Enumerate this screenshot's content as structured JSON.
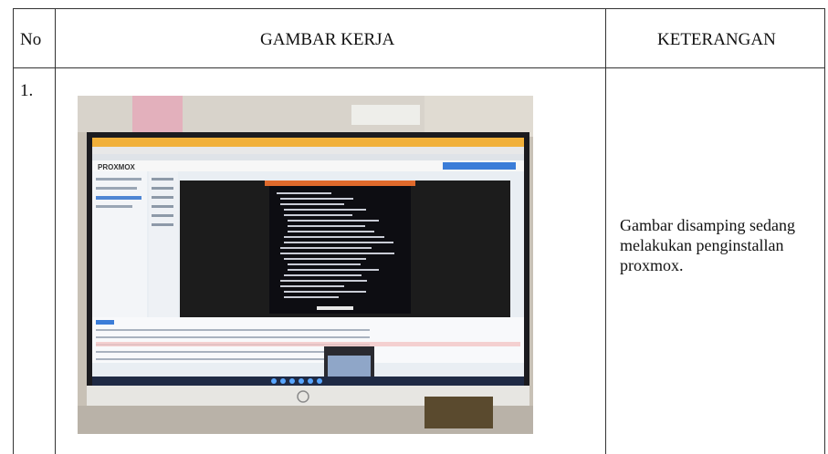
{
  "table": {
    "headers": [
      "No",
      "GAMBAR KERJA",
      "KETERANGAN"
    ],
    "rows": [
      {
        "no": "1.",
        "photo_alt": "Monitor displaying Proxmox installation in a web console",
        "keterangan": "Gambar disamping sedang melakukan penginstallan proxmox."
      }
    ]
  },
  "photo": {
    "browser_brand_text": "PROXMOX",
    "console_title": "",
    "monitor_brand": "hp"
  },
  "colors": {
    "border": "#333333",
    "console_bar": "#e06a2c",
    "taskbar": "#1f2a44"
  }
}
